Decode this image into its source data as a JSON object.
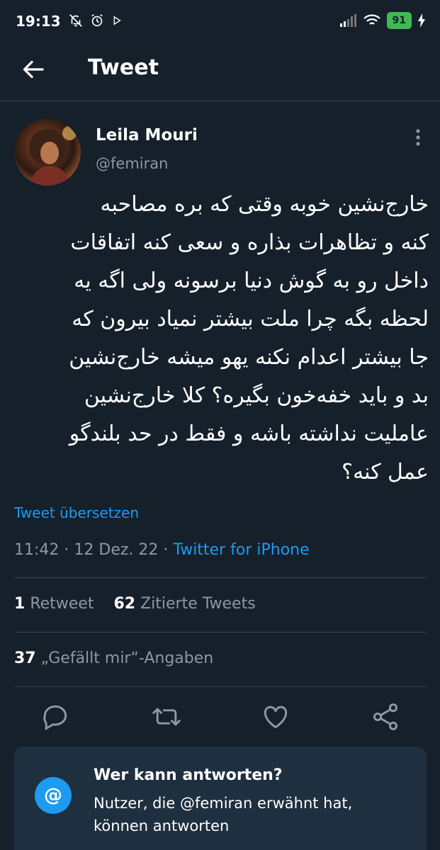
{
  "status_bar": {
    "time": "19:13",
    "battery": "91"
  },
  "header": {
    "title": "Tweet"
  },
  "user": {
    "name": "Leila Mouri",
    "handle": "@femiran"
  },
  "tweet": {
    "lines": [
      "خارج‌نشین خوبه وقتی که بره مصاحبه",
      "کنه و تظاهرات بذاره و سعی کنه اتفاقات",
      "داخل رو به گوش دنیا برسونه ولی اگه یه",
      "لحظه بگه چرا ملت بیشتر نمیاد بیرون که",
      "جا بیشتر اعدام نکنه یهو میشه خارج‌نشین",
      "بد و باید خفه‌خون بگیره؟ کلا خارج‌نشین",
      "عاملیت نداشته باشه و فقط در حد بلندگو",
      "عمل کنه؟"
    ],
    "translate_label": "Tweet übersetzen",
    "time": "11:42",
    "date": "12 Dez. 22",
    "source": "Twitter for iPhone"
  },
  "stats": {
    "retweets_count": "1",
    "retweets_label": "Retweet",
    "quotes_count": "62",
    "quotes_label": "Zitierte Tweets",
    "likes_count": "37",
    "likes_label": "„Gefällt mir“-Angaben"
  },
  "reply_card": {
    "icon_symbol": "@",
    "title": "Wer kann antworten?",
    "body": "Nutzer, die @femiran erwähnt hat, können antworten"
  },
  "colors": {
    "background": "#15202b",
    "accent": "#1d9bf0",
    "muted": "#8b98a5",
    "card": "#1e2f3f"
  }
}
